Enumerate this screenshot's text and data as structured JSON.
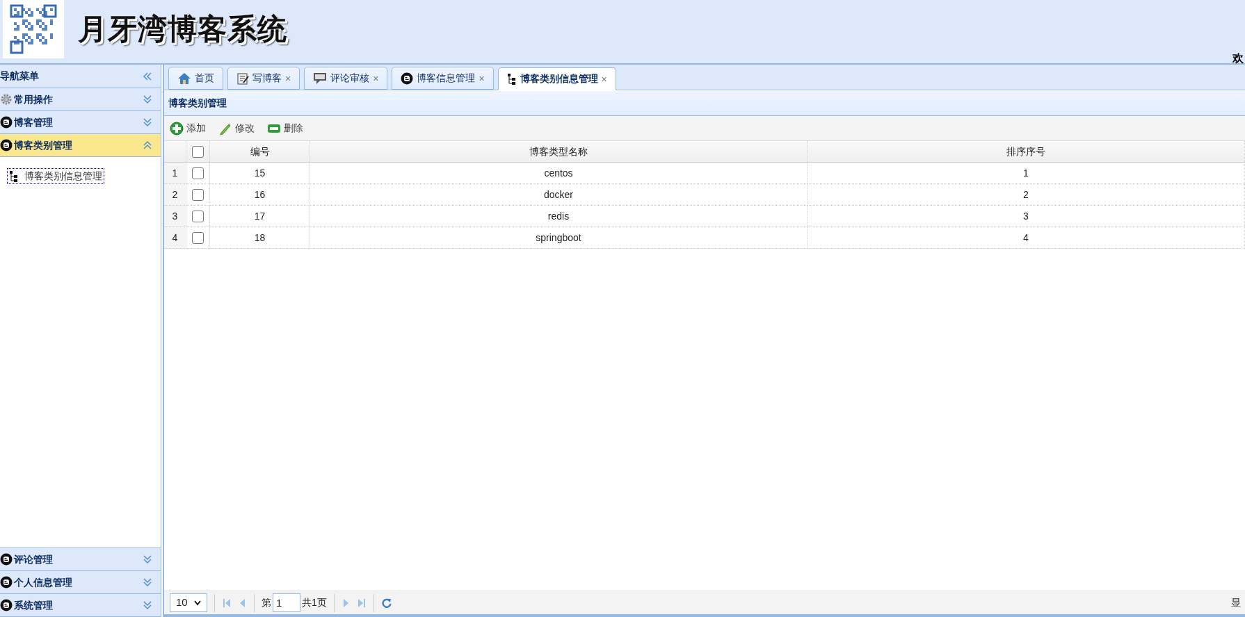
{
  "header": {
    "title": "月牙湾博客系统",
    "welcome": "欢"
  },
  "sidebar": {
    "title": "导航菜单",
    "sections": [
      {
        "label": "常用操作",
        "kind": "gear",
        "expanded": false
      },
      {
        "label": "博客管理",
        "kind": "blog",
        "expanded": false
      },
      {
        "label": "博客类别管理",
        "kind": "blog",
        "expanded": true,
        "children": [
          {
            "label": "博客类别信息管理",
            "selected": true
          }
        ]
      },
      {
        "label": "评论管理",
        "kind": "blog",
        "expanded": false
      },
      {
        "label": "个人信息管理",
        "kind": "blog",
        "expanded": false
      },
      {
        "label": "系统管理",
        "kind": "blog",
        "expanded": false
      }
    ]
  },
  "tabs": [
    {
      "label": "首页",
      "kind": "home",
      "selected": false
    },
    {
      "label": "写博客",
      "kind": "edit",
      "close": "×",
      "selected": false
    },
    {
      "label": "评论审核",
      "kind": "comment",
      "close": "×",
      "selected": false
    },
    {
      "label": "博客信息管理",
      "kind": "blog",
      "close": "×",
      "selected": false
    },
    {
      "label": "博客类别信息管理",
      "kind": "tree",
      "close": "×",
      "selected": true
    }
  ],
  "panel": {
    "title": "博客类别管理"
  },
  "toolbar": [
    {
      "label": "添加",
      "kind": "add"
    },
    {
      "label": "修改",
      "kind": "pencil"
    },
    {
      "label": "删除",
      "kind": "remove"
    }
  ],
  "table": {
    "all_checked": false,
    "columns": [
      "编号",
      "博客类型名称",
      "排序序号"
    ],
    "rows": [
      {
        "index": "1",
        "checked": false,
        "cells": [
          "15",
          "centos",
          "1"
        ]
      },
      {
        "index": "2",
        "checked": false,
        "cells": [
          "16",
          "docker",
          "2"
        ]
      },
      {
        "index": "3",
        "checked": false,
        "cells": [
          "17",
          "redis",
          "3"
        ]
      },
      {
        "index": "4",
        "checked": false,
        "cells": [
          "18",
          "springboot",
          "4"
        ]
      }
    ]
  },
  "pager": {
    "page_size": "10",
    "page_prefix": "第",
    "page": "1",
    "page_total": "共1页",
    "info": "显"
  }
}
